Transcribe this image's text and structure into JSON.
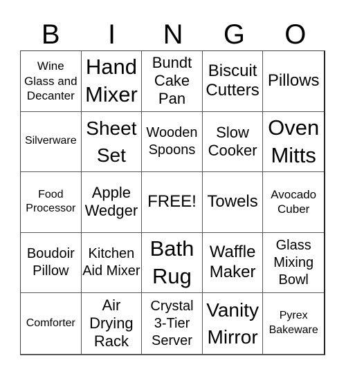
{
  "header": {
    "letters": [
      "B",
      "I",
      "N",
      "G",
      "O"
    ]
  },
  "cells": [
    "Wine Glass and Decanter",
    "Hand Mixer",
    "Bundt Cake Pan",
    "Biscuit Cutters",
    "Pillows",
    "Silverware",
    "Sheet Set",
    "Wooden Spoons",
    "Slow Cooker",
    "Oven Mitts",
    "Food Processor",
    "Apple Wedger",
    "FREE!",
    "Towels",
    "Avocado Cuber",
    "Boudoir Pillow",
    "Kitchen Aid Mixer",
    "Bath Rug",
    "Waffle Maker",
    "Glass Mixing Bowl",
    "Comforter",
    "Air Drying Rack",
    "Crystal 3-Tier Server",
    "Vanity Mirror",
    "Pyrex Bakeware"
  ]
}
